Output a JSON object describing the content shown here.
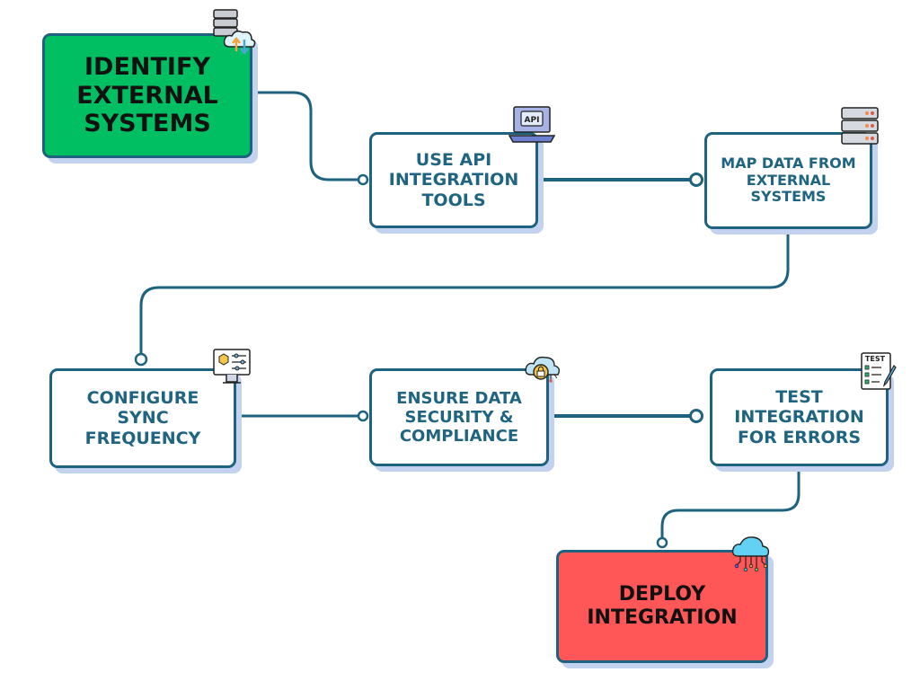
{
  "steps": [
    {
      "label": "IDENTIFY\nEXTERNAL\nSYSTEMS",
      "icon": "server-cloud-sync-icon",
      "color": "#00BF63"
    },
    {
      "label": "USE API\nINTEGRATION\nTOOLS",
      "icon": "api-laptop-icon",
      "color": "#FFFFFF",
      "icon_text": "API"
    },
    {
      "label": "MAP DATA FROM\nEXTERNAL\nSYSTEMS",
      "icon": "server-rack-icon",
      "color": "#FFFFFF"
    },
    {
      "label": "CONFIGURE\nSYNC\nFREQUENCY",
      "icon": "monitor-settings-icon",
      "color": "#FFFFFF"
    },
    {
      "label": "ENSURE DATA\nSECURITY &\nCOMPLIANCE",
      "icon": "cloud-lock-icon",
      "color": "#FFFFFF"
    },
    {
      "label": "TEST\nINTEGRATION\nFOR ERRORS",
      "icon": "test-checklist-icon",
      "color": "#FFFFFF",
      "icon_text": "TEST"
    },
    {
      "label": "DEPLOY\nINTEGRATION",
      "icon": "cloud-network-icon",
      "color": "#FF5757"
    }
  ],
  "colors": {
    "border": "#1D6380",
    "text": "#1F6480",
    "shadow": "#C3D2EE",
    "start": "#00BF63",
    "end": "#FF5757"
  }
}
